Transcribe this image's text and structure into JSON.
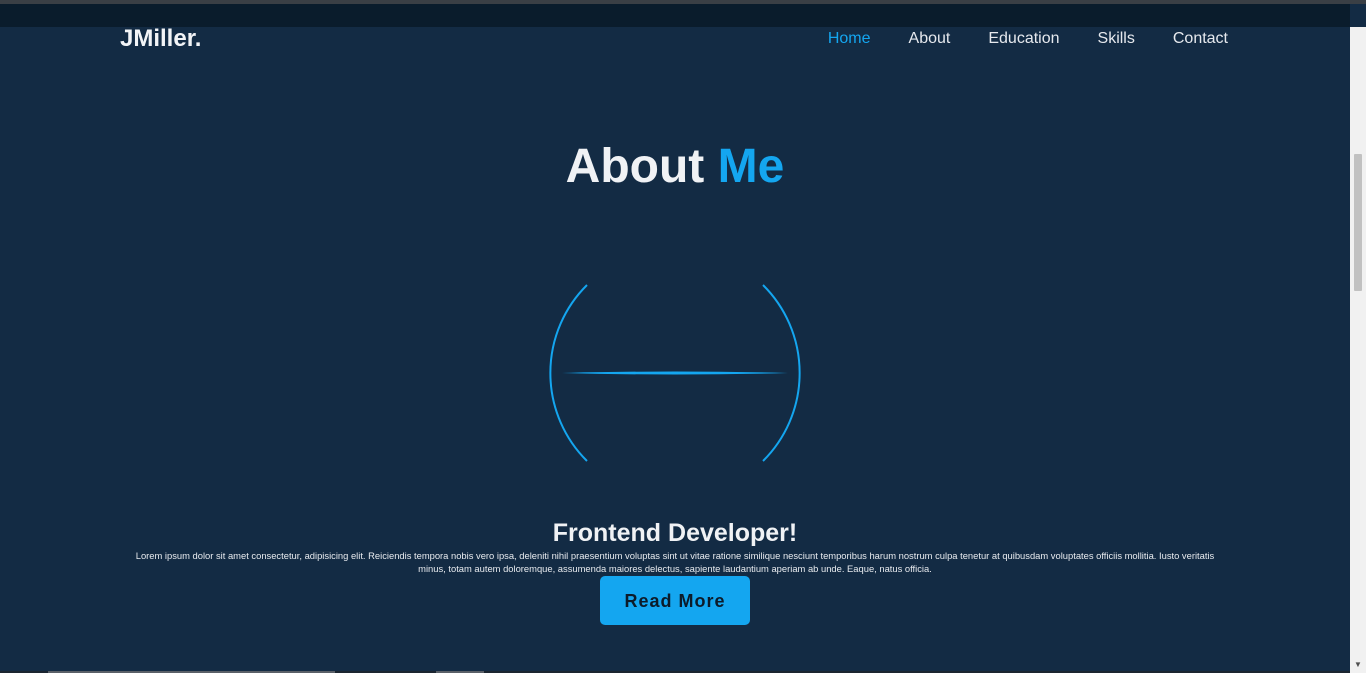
{
  "header": {
    "logo": "JMiller.",
    "nav": [
      {
        "label": "Home",
        "active": true
      },
      {
        "label": "About",
        "active": false
      },
      {
        "label": "Education",
        "active": false
      },
      {
        "label": "Skills",
        "active": false
      },
      {
        "label": "Contact",
        "active": false
      }
    ]
  },
  "about": {
    "title_main": "About",
    "title_accent": "Me",
    "role": "Frontend Developer!",
    "description": "Lorem ipsum dolor sit amet consectetur, adipisicing elit. Reiciendis tempora nobis vero ipsa, deleniti nihil praesentium voluptas sint ut vitae ratione similique nesciunt temporibus harum nostrum culpa tenetur at quibusdam voluptates officiis mollitia. Iusto veritatis minus, totam autem doloremque, assumenda maiores delectus, sapiente laudantium aperiam ab unde. Eaque, natus officia.",
    "button_label": "Read More"
  },
  "colors": {
    "background": "#132b44",
    "header_bg": "#0a1c2c",
    "accent": "#14a6f0",
    "text": "#f0f2f5"
  },
  "icons": {
    "scroll_down": "chevron-down-icon"
  }
}
